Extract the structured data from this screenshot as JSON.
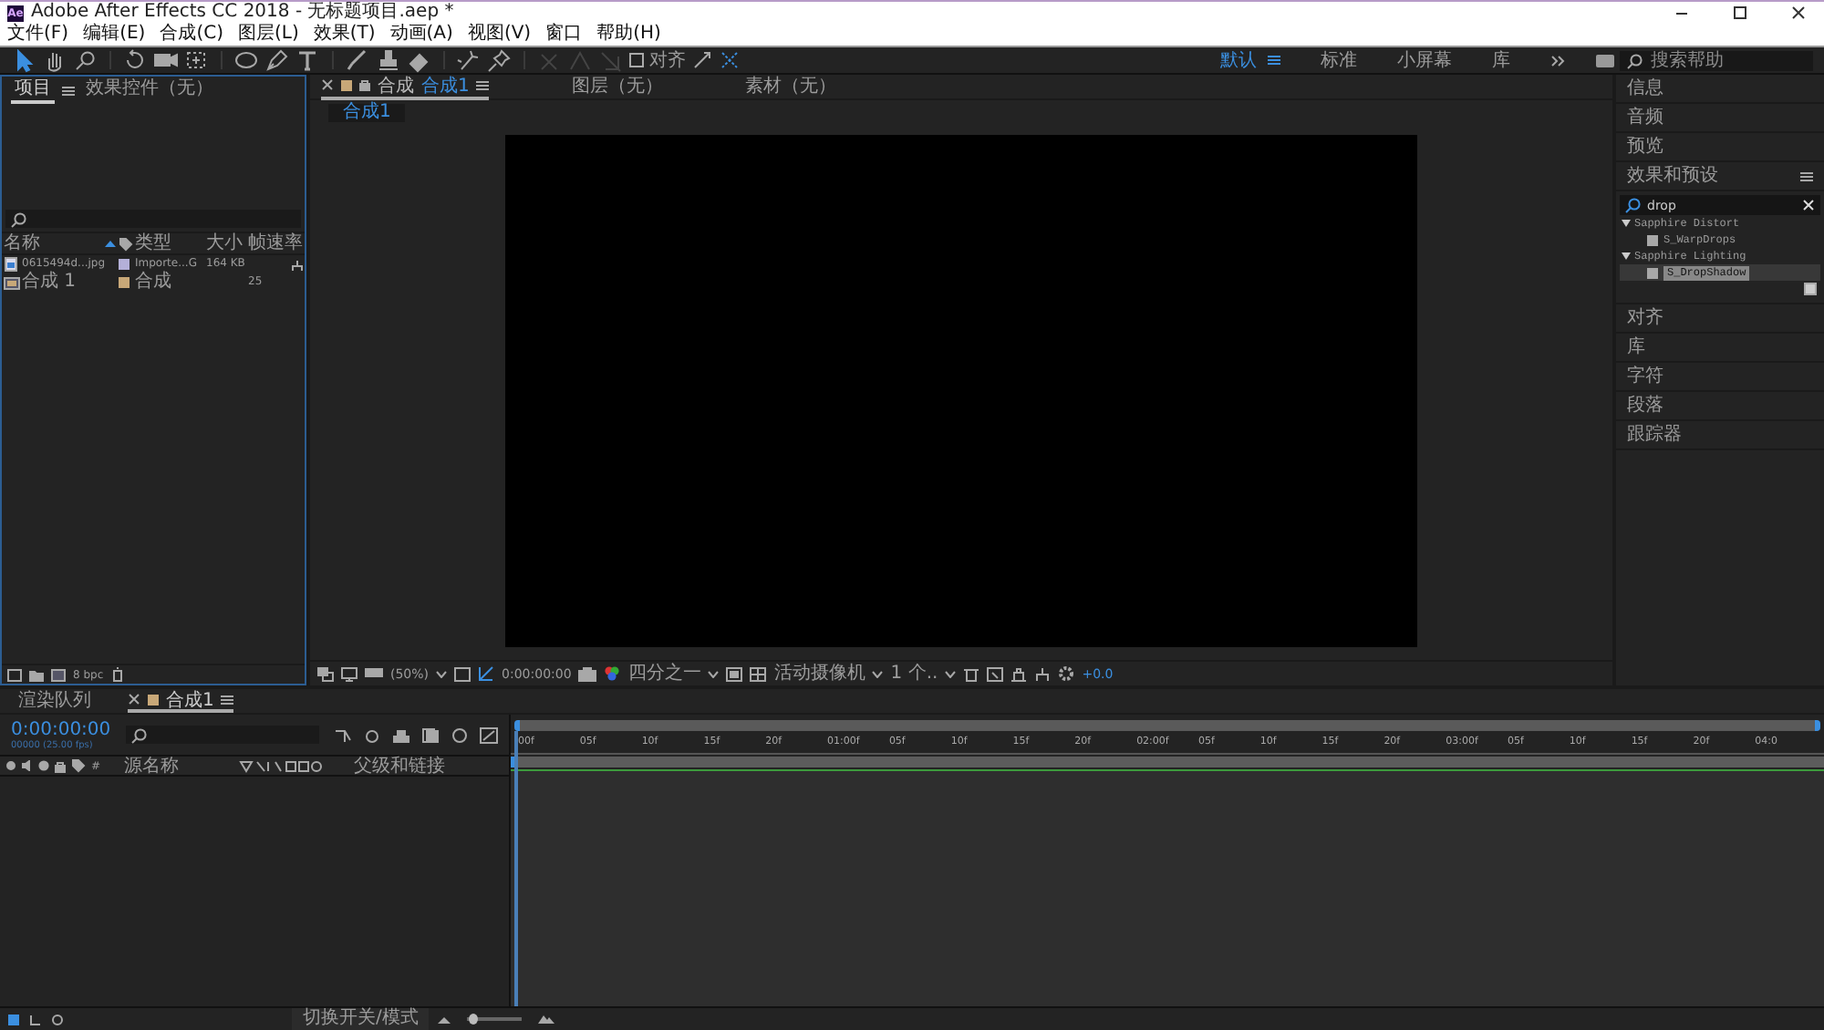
{
  "window": {
    "logo": "Ae",
    "title": "Adobe After Effects CC 2018 - 无标题项目.aep *"
  },
  "menu": [
    "文件(F)",
    "编辑(E)",
    "合成(C)",
    "图层(L)",
    "效果(T)",
    "动画(A)",
    "视图(V)",
    "窗口",
    "帮助(H)"
  ],
  "toolbar": {
    "tools": [
      {
        "kind": "arrow",
        "selected": true
      },
      {
        "kind": "hand",
        "selected": false
      },
      {
        "kind": "zoom",
        "selected": false
      },
      {
        "kind": "rotate",
        "selected": false
      },
      {
        "kind": "camera",
        "selected": false
      },
      {
        "kind": "pan",
        "selected": false
      },
      {
        "kind": "ellipse",
        "selected": false
      },
      {
        "kind": "pen",
        "selected": false
      },
      {
        "kind": "text",
        "selected": false
      },
      {
        "kind": "brush",
        "selected": false
      },
      {
        "kind": "stamp",
        "selected": false
      },
      {
        "kind": "eraser",
        "selected": false
      },
      {
        "kind": "roto",
        "selected": false
      },
      {
        "kind": "pin",
        "selected": false
      }
    ],
    "align": {
      "label": "对齐",
      "checked": false
    },
    "workspaces": [
      {
        "label": "默认",
        "selected": true
      },
      {
        "label": "标准",
        "selected": false
      },
      {
        "label": "小屏幕",
        "selected": false
      },
      {
        "label": "库",
        "selected": false
      }
    ],
    "search": {
      "placeholder": "搜索帮助"
    }
  },
  "project_panel": {
    "tabs": [
      {
        "label": "项目",
        "selected": true
      },
      {
        "label": "效果控件（无）",
        "selected": false
      }
    ],
    "columns": [
      "名称",
      "类型",
      "大小",
      "帧速率"
    ],
    "rows": [
      {
        "kind": "image",
        "name": "0615494d...jpg",
        "type": "Importe...G",
        "size": "164 KB",
        "color": "#b4b0d8"
      },
      {
        "kind": "comp",
        "name": "合成 1",
        "type": "合成",
        "fps": "25",
        "color": "#c8a878"
      }
    ],
    "footer": "8 bpc"
  },
  "viewer": {
    "tabs": [
      {
        "label": "合成",
        "comp": "合成1",
        "color": "#c8a878",
        "selected": true
      },
      {
        "label": "图层（无）",
        "selected": false
      },
      {
        "label": "素材（无）",
        "selected": false
      }
    ],
    "breadcrumb": "合成1",
    "controls": {
      "magnification": "(50%)",
      "timecode": "0:00:00:00",
      "resolution": "四分之一",
      "camera": "活动摄像机",
      "views": "1 个..",
      "exposure": "+0.0"
    }
  },
  "side_panel": {
    "sections": [
      {
        "label": "信息",
        "expanded": false
      },
      {
        "label": "音频",
        "expanded": false
      },
      {
        "label": "预览",
        "expanded": false
      },
      {
        "label": "效果和预设",
        "expanded": true
      },
      {
        "label": "对齐",
        "expanded": false
      },
      {
        "label": "库",
        "expanded": false
      },
      {
        "label": "字符",
        "expanded": false
      },
      {
        "label": "段落",
        "expanded": false
      },
      {
        "label": "跟踪器",
        "expanded": false
      }
    ],
    "effects_search": {
      "value": "drop"
    },
    "effects_tree": [
      {
        "label": "Sapphire Distort",
        "expanded": true,
        "children": [
          {
            "label": "S_WarpDrops",
            "selected": false
          }
        ]
      },
      {
        "label": "Sapphire Lighting",
        "expanded": true,
        "children": [
          {
            "label": "S_DropShadow",
            "selected": true
          }
        ]
      }
    ]
  },
  "timeline": {
    "tabs": [
      {
        "label": "渲染队列",
        "selected": false
      },
      {
        "label": "合成1",
        "color": "#c8a878",
        "selected": true
      }
    ],
    "timecode": "0:00:00:00",
    "frames": "00000 (25.00 fps)",
    "columns": [
      "#",
      "源名称",
      "父级和链接"
    ],
    "ruler": [
      "00f",
      "05f",
      "10f",
      "15f",
      "20f",
      "01:00f",
      "05f",
      "10f",
      "15f",
      "20f",
      "02:00f",
      "05f",
      "10f",
      "15f",
      "20f",
      "03:00f",
      "05f",
      "10f",
      "15f",
      "20f",
      "04:0"
    ]
  },
  "status_bar": {
    "toggle": "切换开关/模式",
    "zoom_slider": {
      "level": 0.1
    }
  }
}
